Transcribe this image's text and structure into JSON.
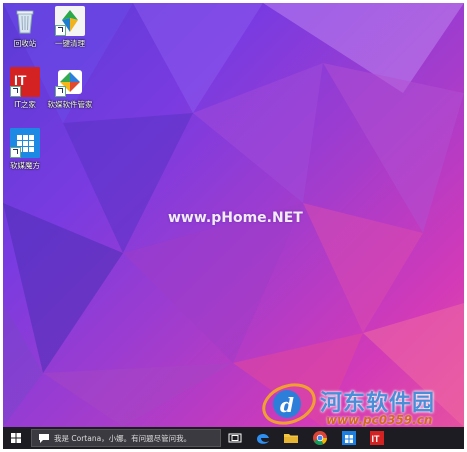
{
  "desktop": {
    "icons": [
      {
        "label": "回收站",
        "icon": "recycle-bin-icon"
      },
      {
        "label": "一键清理",
        "icon": "cleanup-icon"
      },
      {
        "label": "IT之家",
        "icon": "ithome-icon",
        "badge": "IT"
      },
      {
        "label": "软媒软件管家",
        "icon": "software-manager-icon"
      },
      {
        "label": "软媒魔方",
        "icon": "rubik-icon"
      }
    ],
    "watermark": "www.pHome.NET"
  },
  "taskbar": {
    "search_text": "我是 Cortana，小娜。有问题尽管问我。",
    "pinned": [
      "task-view-icon",
      "edge-icon",
      "file-explorer-icon",
      "chrome-icon",
      "store-icon",
      "ithome-icon"
    ]
  },
  "overlay_logo": {
    "title": "河东软件园",
    "url": "www.pc0359.cn"
  },
  "colors": {
    "wallpaper_start": "#5a3bd6",
    "wallpaper_end": "#e8539e",
    "taskbar": "#1c1c22",
    "logo_blue": "#4a8ed8",
    "logo_orange": "#d26a1f"
  }
}
